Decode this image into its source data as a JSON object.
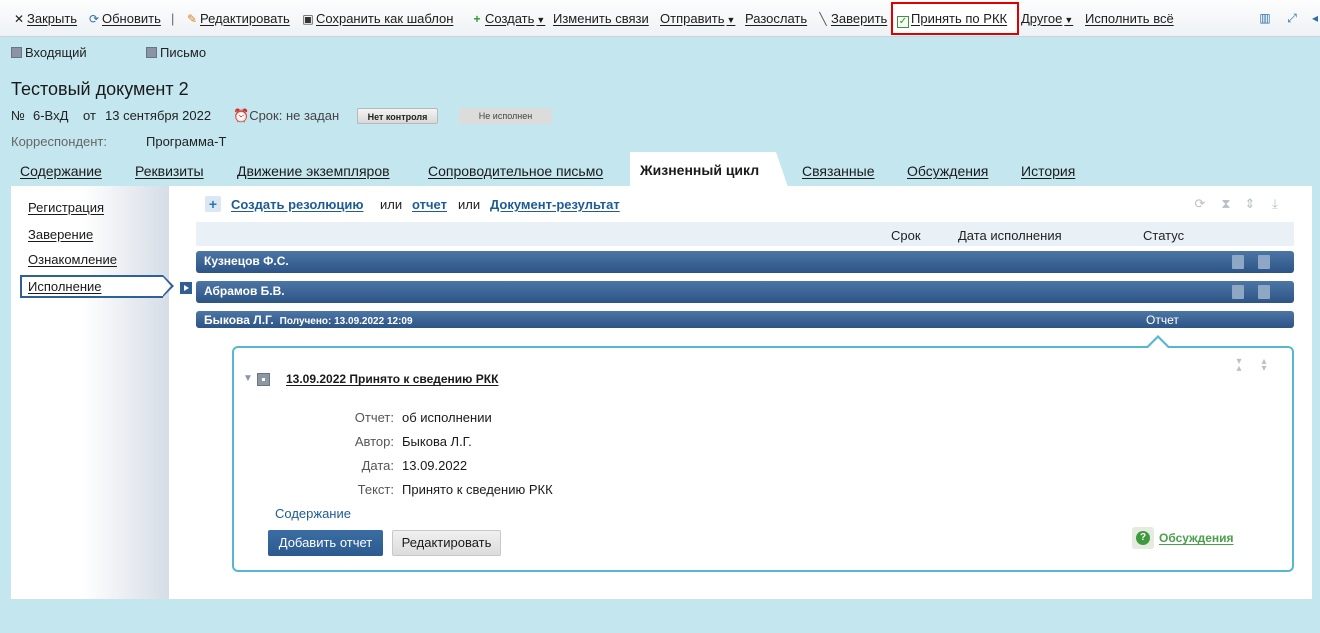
{
  "toolbar": {
    "close": "Закрыть",
    "refresh": "Обновить",
    "edit": "Редактировать",
    "save_template": "Сохранить как шаблон",
    "create": "Создать",
    "change_links": "Изменить связи",
    "send": "Отправить",
    "distribute": "Разослать",
    "certify": "Заверить",
    "accept_rkk": "Принять по РКК",
    "other": "Другое",
    "execute_all": "Исполнить всё"
  },
  "header": {
    "chip_incoming": "Входящий",
    "chip_letter": "Письмо",
    "title": "Тестовый документ 2",
    "number_prefix": "№",
    "number": "6-ВхД",
    "date_prefix": "от",
    "date": "13 сентября 2022",
    "deadline": "Срок: не задан",
    "control_badge": "Нет контроля",
    "exec_badge": "Не исполнен",
    "correspondent_label": "Корреспондент:",
    "correspondent_value": "Программа-Т"
  },
  "tabs": [
    {
      "label": "Содержание"
    },
    {
      "label": "Реквизиты"
    },
    {
      "label": "Движение экземпляров"
    },
    {
      "label": "Сопроводительное письмо"
    },
    {
      "label": "Жизненный цикл"
    },
    {
      "label": "Связанные"
    },
    {
      "label": "Обсуждения"
    },
    {
      "label": "История"
    }
  ],
  "sidebar": {
    "items": [
      {
        "label": "Регистрация"
      },
      {
        "label": "Заверение"
      },
      {
        "label": "Ознакомление"
      },
      {
        "label": "Исполнение"
      }
    ]
  },
  "create_row": {
    "create_resolution": "Создать резолюцию",
    "or1": "или",
    "report": "отчет",
    "or2": "или",
    "result_doc": "Документ-результат"
  },
  "columns": {
    "deadline": "Срок",
    "exec_date": "Дата исполнения",
    "status": "Статус"
  },
  "rows": [
    {
      "name": "Кузнецов Ф.С.",
      "received": "",
      "status": ""
    },
    {
      "name": "Абрамов Б.В.",
      "received": "",
      "status": ""
    },
    {
      "name": "Быкова Л.Г.",
      "received": "Получено: 13.09.2022 12:09",
      "status": "Отчет"
    }
  ],
  "report": {
    "title": "13.09.2022 Принято к сведению РКК",
    "fields": [
      {
        "label": "Отчет:",
        "value": "об исполнении"
      },
      {
        "label": "Автор:",
        "value": "Быкова Л.Г."
      },
      {
        "label": "Дата:",
        "value": "13.09.2022"
      },
      {
        "label": "Текст:",
        "value": "Принято к сведению РКК"
      }
    ],
    "content_link": "Содержание",
    "add_report_button": "Добавить отчет",
    "edit_button": "Редактировать",
    "discussions_link": "Обсуждения"
  }
}
